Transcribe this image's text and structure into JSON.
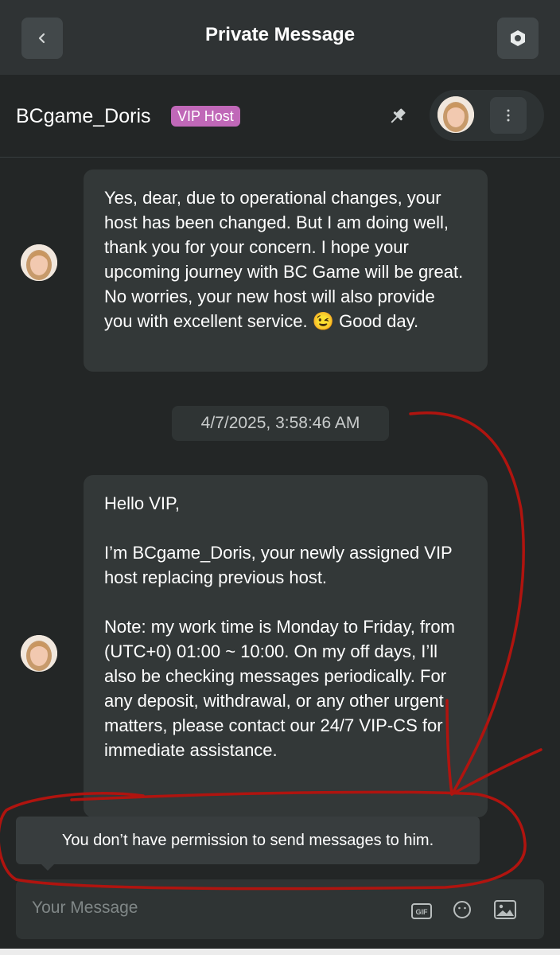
{
  "topbar": {
    "title": "Private Message"
  },
  "header": {
    "host_name": "BCgame_Doris",
    "badge": "VIP Host"
  },
  "messages": [
    {
      "text": "Yes, dear, due to operational changes, your host has been changed. But I am doing well, thank you for your concern. I hope your upcoming journey with BC Game will be great. No worries, your new host will also provide you with excellent service. 😉 Good day."
    },
    {
      "text": "Hello VIP,\n\nI’m BCgame_Doris, your newly assigned VIP host replacing previous host.\n\nNote: my work time is Monday to Friday, from (UTC+0) 01:00 ~ 10:00. On my off days, I’ll also be checking messages periodically. For any deposit, withdrawal, or any other urgent matters, please contact our 24/7 VIP-CS for immediate assistance."
    }
  ],
  "timestamp": "4/7/2025, 3:58:46 AM",
  "toast": "You don’t have permission to send messages to him.",
  "composer": {
    "placeholder": "Your Message",
    "gif_label": "GIF"
  },
  "icons": [
    "back-icon",
    "settings-icon",
    "pin-icon",
    "more-icon",
    "gif-icon",
    "emoji-icon",
    "image-icon"
  ],
  "colors": {
    "accent_badge": "#c068b8",
    "annotation": "#b0140f",
    "background": "#232626"
  }
}
